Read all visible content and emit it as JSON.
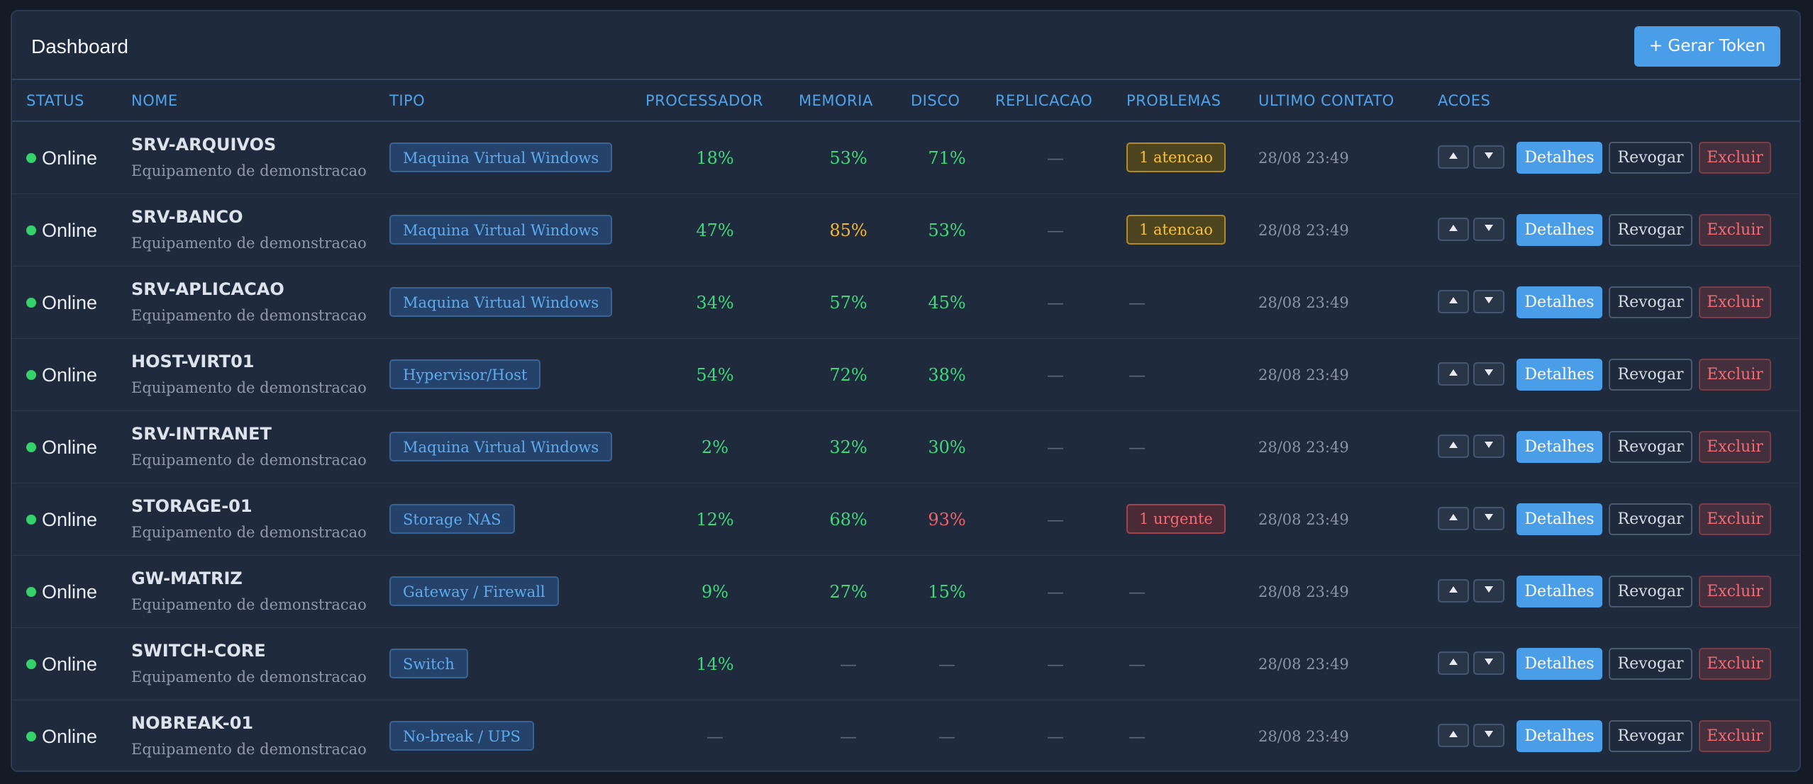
{
  "header": {
    "title": "Dashboard",
    "token_button": "+ Gerar Token"
  },
  "columns": {
    "status": "STATUS",
    "nome": "NOME",
    "tipo": "TIPO",
    "processador": "PROCESSADOR",
    "memoria": "MEMORIA",
    "disco": "DISCO",
    "replicacao": "REPLICACAO",
    "problemas": "PROBLEMAS",
    "ultimo_contato": "ULTIMO CONTATO",
    "acoes": "ACOES"
  },
  "actions": {
    "up_icon": "triangle-up-icon",
    "down_icon": "triangle-down-icon",
    "details": "Detalhes",
    "revoke": "Revogar",
    "delete": "Excluir"
  },
  "colors": {
    "accent": "#4a9ee8",
    "online": "#34d36a",
    "ok": "#3fd97a",
    "warning": "#f5b82e",
    "critical": "#f0606b"
  },
  "rows": [
    {
      "status": "Online",
      "name": "SRV-ARQUIVOS",
      "desc": "Equipamento de demonstracao",
      "tipo": "Maquina Virtual Windows",
      "cpu": "18%",
      "cpu_level": "ok",
      "mem": "53%",
      "mem_level": "ok",
      "disk": "71%",
      "disk_level": "ok",
      "repl": "—",
      "problem": "1 atencao",
      "problem_level": "warning",
      "contact": "28/08 23:49"
    },
    {
      "status": "Online",
      "name": "SRV-BANCO",
      "desc": "Equipamento de demonstracao",
      "tipo": "Maquina Virtual Windows",
      "cpu": "47%",
      "cpu_level": "ok",
      "mem": "85%",
      "mem_level": "warning",
      "disk": "53%",
      "disk_level": "ok",
      "repl": "—",
      "problem": "1 atencao",
      "problem_level": "warning",
      "contact": "28/08 23:49"
    },
    {
      "status": "Online",
      "name": "SRV-APLICACAO",
      "desc": "Equipamento de demonstracao",
      "tipo": "Maquina Virtual Windows",
      "cpu": "34%",
      "cpu_level": "ok",
      "mem": "57%",
      "mem_level": "ok",
      "disk": "45%",
      "disk_level": "ok",
      "repl": "—",
      "problem": "—",
      "problem_level": "none",
      "contact": "28/08 23:49"
    },
    {
      "status": "Online",
      "name": "HOST-VIRT01",
      "desc": "Equipamento de demonstracao",
      "tipo": "Hypervisor/Host",
      "cpu": "54%",
      "cpu_level": "ok",
      "mem": "72%",
      "mem_level": "ok",
      "disk": "38%",
      "disk_level": "ok",
      "repl": "—",
      "problem": "—",
      "problem_level": "none",
      "contact": "28/08 23:49"
    },
    {
      "status": "Online",
      "name": "SRV-INTRANET",
      "desc": "Equipamento de demonstracao",
      "tipo": "Maquina Virtual Windows",
      "cpu": "2%",
      "cpu_level": "ok",
      "mem": "32%",
      "mem_level": "ok",
      "disk": "30%",
      "disk_level": "ok",
      "repl": "—",
      "problem": "—",
      "problem_level": "none",
      "contact": "28/08 23:49"
    },
    {
      "status": "Online",
      "name": "STORAGE-01",
      "desc": "Equipamento de demonstracao",
      "tipo": "Storage NAS",
      "cpu": "12%",
      "cpu_level": "ok",
      "mem": "68%",
      "mem_level": "ok",
      "disk": "93%",
      "disk_level": "critical",
      "repl": "—",
      "problem": "1 urgente",
      "problem_level": "urgent",
      "contact": "28/08 23:49"
    },
    {
      "status": "Online",
      "name": "GW-MATRIZ",
      "desc": "Equipamento de demonstracao",
      "tipo": "Gateway / Firewall",
      "cpu": "9%",
      "cpu_level": "ok",
      "mem": "27%",
      "mem_level": "ok",
      "disk": "15%",
      "disk_level": "ok",
      "repl": "—",
      "problem": "—",
      "problem_level": "none",
      "contact": "28/08 23:49"
    },
    {
      "status": "Online",
      "name": "SWITCH-CORE",
      "desc": "Equipamento de demonstracao",
      "tipo": "Switch",
      "cpu": "14%",
      "cpu_level": "ok",
      "mem": "—",
      "mem_level": "none",
      "disk": "—",
      "disk_level": "none",
      "repl": "—",
      "problem": "—",
      "problem_level": "none",
      "contact": "28/08 23:49"
    },
    {
      "status": "Online",
      "name": "NOBREAK-01",
      "desc": "Equipamento de demonstracao",
      "tipo": "No-break / UPS",
      "cpu": "—",
      "cpu_level": "none",
      "mem": "—",
      "mem_level": "none",
      "disk": "—",
      "disk_level": "none",
      "repl": "—",
      "problem": "—",
      "problem_level": "none",
      "contact": "28/08 23:49"
    }
  ]
}
